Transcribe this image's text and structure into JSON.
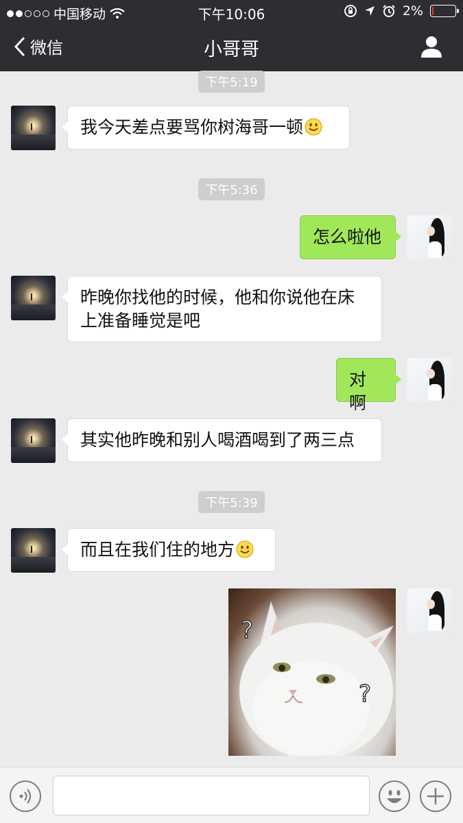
{
  "status_bar": {
    "carrier": "中国移动",
    "time": "下午10:06",
    "battery": "2%",
    "battery_level": 0.02,
    "signal_icon": "signal-dots-icon",
    "wifi_icon": "wifi-icon"
  },
  "nav": {
    "back_label": "微信",
    "title": "小哥哥",
    "profile_icon": "person-icon"
  },
  "messages": [
    {
      "type": "time",
      "text": "下午5:19"
    },
    {
      "type": "in",
      "text": "我今天差点要骂你树海哥一顿",
      "emoji": "smile-emoji-icon"
    },
    {
      "type": "time",
      "text": "下午5:36"
    },
    {
      "type": "out",
      "text": "怎么啦他"
    },
    {
      "type": "in",
      "text_line1": "昨晚你找他的时候，他和你说他在床",
      "text_line2": "上准备睡觉是吧"
    },
    {
      "type": "out",
      "text": "对啊"
    },
    {
      "type": "in",
      "text": "其实他昨晚和别人喝酒喝到了两三点"
    },
    {
      "type": "time",
      "text": "下午5:39"
    },
    {
      "type": "in",
      "text": "而且在我们住的地方",
      "emoji": "smile-emoji-icon"
    },
    {
      "type": "out-image",
      "description": "white-cat-sticker",
      "marks": [
        "?",
        "?"
      ]
    }
  ],
  "input_bar": {
    "voice_icon": "voice-icon",
    "text_value": "",
    "emoji_icon": "emoji-icon",
    "plus_icon": "plus-icon"
  },
  "colors": {
    "nav_bg": "#2e2e32",
    "chat_bg": "#ebebeb",
    "out_bubble": "#a0e75a",
    "in_bubble": "#ffffff",
    "stamp_bg": "#cecece"
  }
}
